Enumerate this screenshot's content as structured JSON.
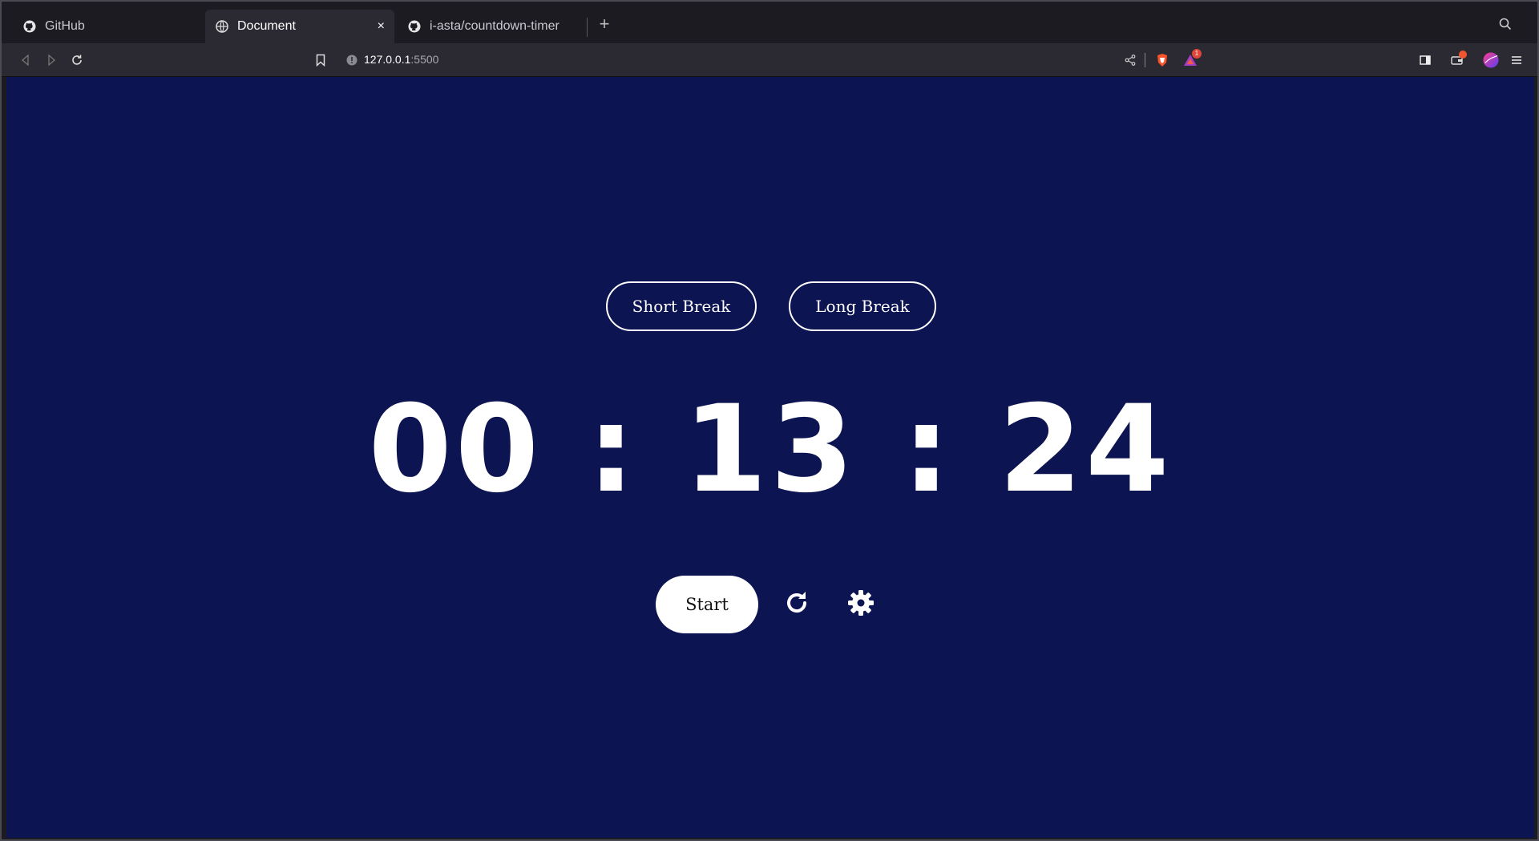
{
  "browser": {
    "tabs": [
      {
        "label": "GitHub",
        "icon": "github-icon"
      },
      {
        "label": "Document",
        "icon": "globe-icon",
        "active": true
      },
      {
        "label": "i-asta/countdown-timer",
        "icon": "github-icon"
      }
    ],
    "new_tab_label": "+",
    "close_label": "×",
    "url_host": "127.0.0.1",
    "url_port": ":5500",
    "notification_count": "1"
  },
  "app": {
    "short_break_label": "Short Break",
    "long_break_label": "Long Break",
    "timer": "00 : 13 : 24",
    "start_label": "Start",
    "background_color": "#0d1452",
    "foreground_color": "#ffffff"
  }
}
